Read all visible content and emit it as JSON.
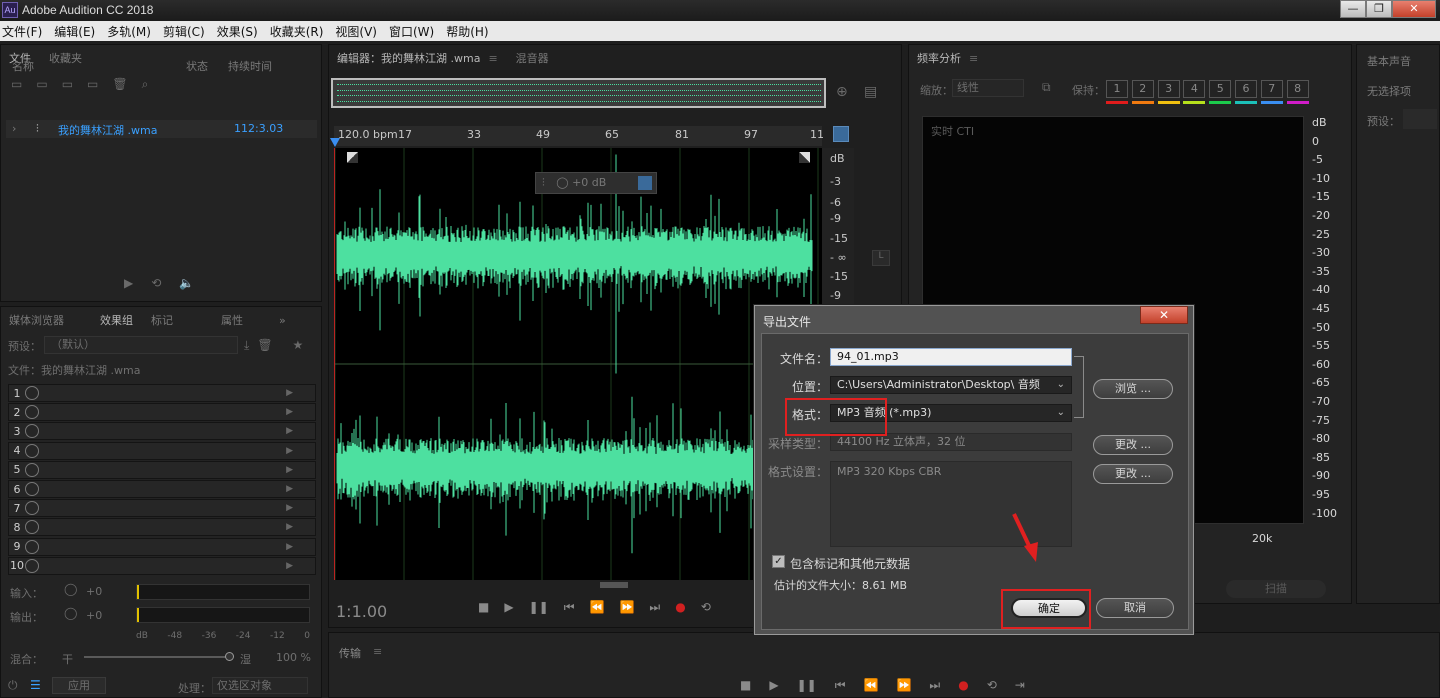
{
  "window": {
    "title": "Adobe Audition CC 2018",
    "icon": "Au",
    "controls": [
      "—",
      "❐",
      "✕"
    ]
  },
  "menu": [
    "文件(F)",
    "编辑(E)",
    "多轨(M)",
    "剪辑(C)",
    "效果(S)",
    "收藏夹(R)",
    "视图(V)",
    "窗口(W)",
    "帮助(H)"
  ],
  "files_panel": {
    "tabs": [
      "文件",
      "收藏夹"
    ],
    "columns": [
      "名称",
      "状态",
      "持续时间"
    ],
    "file": {
      "name": "我的舞林江湖 .wma",
      "duration": "112:3.03"
    }
  },
  "effects_panel": {
    "tabs": [
      "媒体浏览器",
      "效果组",
      "标记",
      "属性"
    ],
    "preset_label": "预设：",
    "preset_value": "（默认）",
    "file_label": "文件：我的舞林江湖 .wma",
    "rack_numbers": [
      "1",
      "2",
      "3",
      "4",
      "5",
      "6",
      "7",
      "8",
      "9",
      "10"
    ],
    "input_label": "输入：",
    "input_value": "+0",
    "output_label": "输出：",
    "output_value": "+0",
    "meter_ticks": [
      "dB",
      "-48",
      "-36",
      "-24",
      "-12",
      "0"
    ],
    "mix_label": "混合：",
    "mix_dry": "干",
    "mix_wet": "湿",
    "mix_value": "100 %",
    "apply_button": "应用",
    "process_label": "处理：",
    "process_value": "仅选区对象"
  },
  "editor": {
    "tabs": [
      "编辑器：我的舞林江湖 .wma",
      "混音器"
    ],
    "bpm": "120.0 bpm",
    "ruler": [
      "17",
      "33",
      "49",
      "65",
      "81",
      "97",
      "11"
    ],
    "db_scale": [
      "dB",
      "-3",
      "-6",
      "-9",
      "-15",
      "- ∞",
      "-15",
      "-9"
    ],
    "hud_value": "+0 dB",
    "time": "1:1.00"
  },
  "freq_panel": {
    "title": "频率分析",
    "scale_label": "缩放：",
    "scale_value": "线性",
    "keep_label": "保持：",
    "keep_buttons": [
      "1",
      "2",
      "3",
      "4",
      "5",
      "6",
      "7",
      "8"
    ],
    "keep_colors": [
      "#e01c1c",
      "#f07a10",
      "#f0c010",
      "#b6e01c",
      "#1ccb4c",
      "#1cc0b8",
      "#3a8ef0",
      "#d01cc8"
    ],
    "realtime_label": "实时 CTI",
    "db_scale": [
      "dB",
      "0",
      "-5",
      "-10",
      "-15",
      "-20",
      "-25",
      "-30",
      "-35",
      "-40",
      "-45",
      "-50",
      "-55",
      "-60",
      "-65",
      "-70",
      "-75",
      "-80",
      "-85",
      "-90",
      "-95",
      "-100"
    ],
    "x_label": "20k",
    "scan_button": "扫描"
  },
  "basic_panel": {
    "title": "基本声音",
    "no_selection": "无选择项",
    "preset_label": "预设："
  },
  "transport_panel": {
    "title": "传输"
  },
  "dialog": {
    "title": "导出文件",
    "filename_label": "文件名：",
    "filename_value": "94_01.mp3",
    "location_label": "位置：",
    "location_value": "C:\\Users\\Administrator\\Desktop\\ 音频",
    "browse_button": "浏览 ...",
    "format_label": "格式：",
    "format_value": "MP3 音频 (*.mp3)",
    "sample_label": "采样类型：",
    "sample_value": "44100 Hz 立体声，32 位",
    "change_button": "更改 ...",
    "format_settings_label": "格式设置：",
    "format_settings_value": "MP3 320 Kbps CBR",
    "include_markers_label": "包含标记和其他元数据",
    "est_size_label": "估计的文件大小：8.61 MB",
    "ok_button": "确定",
    "cancel_button": "取消"
  }
}
